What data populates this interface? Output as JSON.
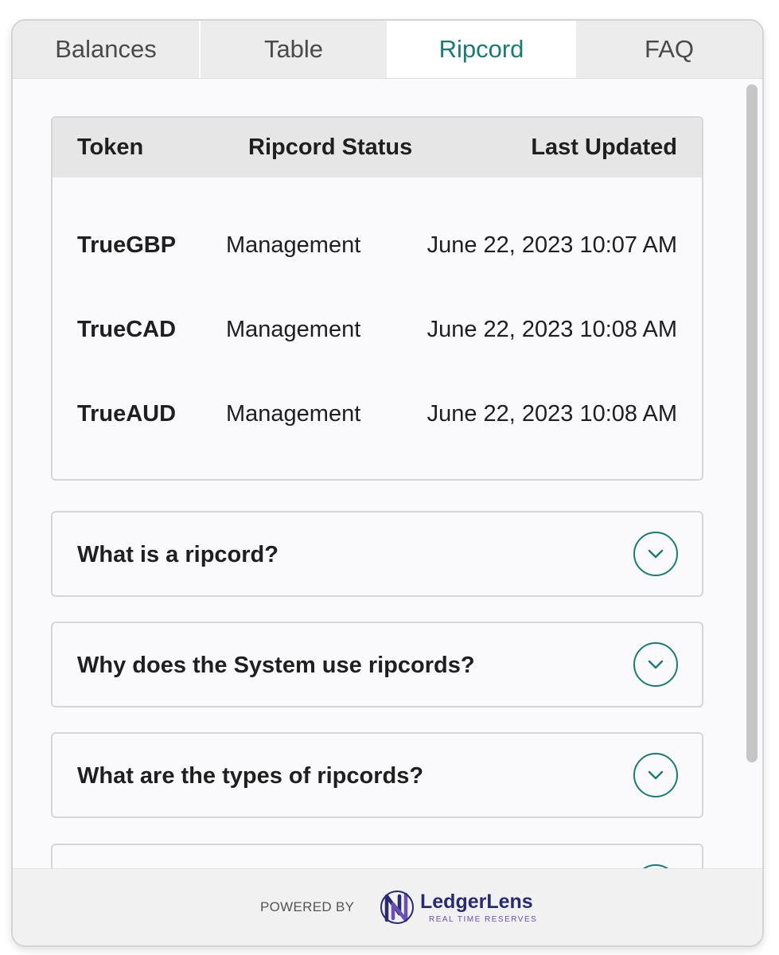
{
  "tabs": [
    {
      "label": "Balances",
      "active": false
    },
    {
      "label": "Table",
      "active": false
    },
    {
      "label": "Ripcord",
      "active": true
    },
    {
      "label": "FAQ",
      "active": false
    }
  ],
  "status_table": {
    "headers": {
      "token": "Token",
      "status": "Ripcord Status",
      "updated": "Last Updated"
    },
    "rows": [
      {
        "token": "TrueGBP",
        "status": "Management",
        "updated": "June 22, 2023 10:07 AM"
      },
      {
        "token": "TrueCAD",
        "status": "Management",
        "updated": "June 22, 2023 10:08 AM"
      },
      {
        "token": "TrueAUD",
        "status": "Management",
        "updated": "June 22, 2023 10:08 AM"
      }
    ]
  },
  "faq": [
    {
      "question": "What is a ripcord?"
    },
    {
      "question": "Why does the System use ripcords?"
    },
    {
      "question": "What are the types of ripcords?"
    },
    {
      "question": ""
    }
  ],
  "footer": {
    "powered_by": "POWERED BY",
    "brand_name": "LedgerLens",
    "brand_tagline": "REAL TIME RESERVES"
  },
  "colors": {
    "accent": "#1a7c74",
    "tab_inactive_bg": "#ececec",
    "brand_navy": "#2a2a6e",
    "brand_purple": "#6a4fb5"
  },
  "icons": {
    "accordion_toggle": "chevron-down-icon",
    "brand": "ledgerlens-logo"
  }
}
